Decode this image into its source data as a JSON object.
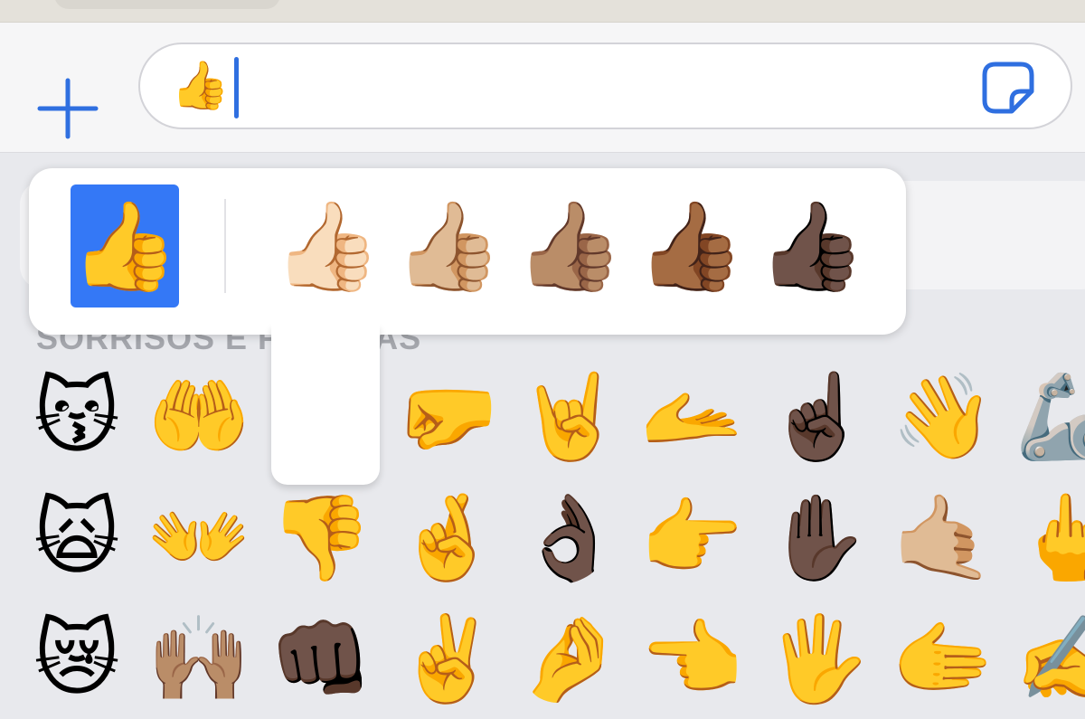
{
  "message_input": {
    "typed_text": "👍"
  },
  "keyboard": {
    "section_title": "SORRISOS E PESSOAS",
    "rows": [
      [
        "😽",
        "🤲",
        "",
        "🤛",
        "🤘",
        "🫴",
        "☝🏿",
        "👋",
        "🦾"
      ],
      [
        "🙀",
        "👐",
        "👎",
        "🤞",
        "👌🏿",
        "👉",
        "✋🏿",
        "🤙🏼",
        "🖕"
      ],
      [
        "😿",
        "🙌🏽",
        "👊🏿",
        "✌️",
        "🤌",
        "👈",
        "🖐️",
        "🫱",
        "✍️"
      ]
    ]
  },
  "skin_tone_picker": {
    "options": [
      {
        "emoji": "👍",
        "selected": true
      },
      {
        "emoji": "👍🏻",
        "selected": false
      },
      {
        "emoji": "👍🏼",
        "selected": false
      },
      {
        "emoji": "👍🏽",
        "selected": false
      },
      {
        "emoji": "👍🏾",
        "selected": false
      },
      {
        "emoji": "👍🏿",
        "selected": false
      }
    ]
  },
  "colors": {
    "accent": "#2f6fe0",
    "selected_background": "#3478f6",
    "keyboard_background": "#e8e9ed",
    "section_title": "#a4a6ac"
  },
  "icons": {
    "add": "plus-icon",
    "sticker": "sticker-icon"
  }
}
